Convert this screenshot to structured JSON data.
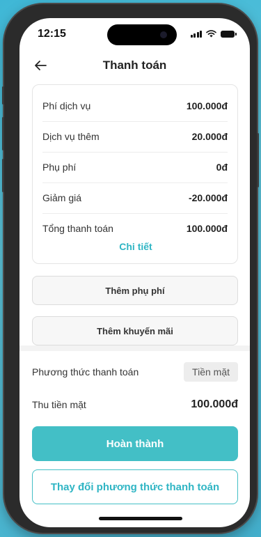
{
  "status_bar": {
    "time": "12:15"
  },
  "header": {
    "title": "Thanh toán"
  },
  "summary": {
    "rows": [
      {
        "label": "Phí dịch vụ",
        "value": "100.000đ"
      },
      {
        "label": "Dịch vụ thêm",
        "value": "20.000đ"
      },
      {
        "label": "Phụ phí",
        "value": "0đ"
      },
      {
        "label": "Giảm giá",
        "value": "-20.000đ"
      },
      {
        "label": "Tổng thanh toán",
        "value": "100.000đ"
      }
    ],
    "details_link": "Chi tiết"
  },
  "actions": {
    "add_surcharge": "Thêm phụ phí",
    "add_promotion": "Thêm khuyến mãi"
  },
  "payment": {
    "method_label": "Phương thức thanh toán",
    "method_value": "Tiền mặt",
    "cash_label": "Thu tiền mặt",
    "cash_value": "100.000đ"
  },
  "buttons": {
    "complete": "Hoàn thành",
    "change_method": "Thay đổi phương thức thanh toán"
  },
  "colors": {
    "accent": "#43bfc6",
    "accent_text": "#2fb5c4"
  }
}
